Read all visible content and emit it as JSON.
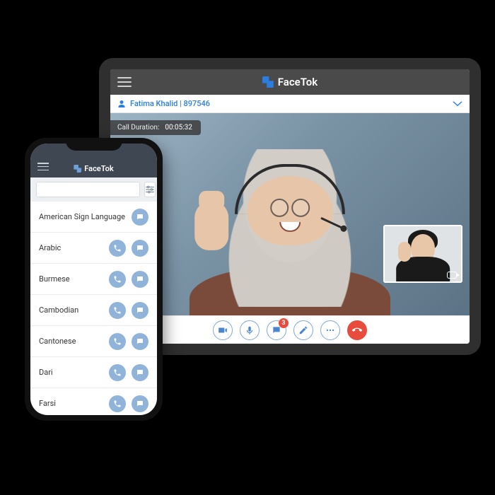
{
  "brand": {
    "name": "FaceTok"
  },
  "colors": {
    "accent": "#2b7de0",
    "danger": "#e74c3c",
    "phoneBtn": "#8fb3d9"
  },
  "tablet": {
    "caller": {
      "name": "Fatima Khalid",
      "id": "897546",
      "display": "Fatima Khalid | 897546"
    },
    "duration": {
      "label": "Call Duration:",
      "value": "00:05:32"
    },
    "chat_badge": "3",
    "toolbar": {
      "video": "Video",
      "mic": "Mic",
      "chat": "Chat",
      "pen": "Annotate",
      "more": "More",
      "hangup": "Hang up"
    }
  },
  "phone": {
    "search_placeholder": "",
    "languages": [
      {
        "label": "American Sign Language",
        "call": false,
        "chat": true
      },
      {
        "label": "Arabic",
        "call": true,
        "chat": true
      },
      {
        "label": "Burmese",
        "call": true,
        "chat": true
      },
      {
        "label": "Cambodian",
        "call": true,
        "chat": true
      },
      {
        "label": "Cantonese",
        "call": true,
        "chat": true
      },
      {
        "label": "Dari",
        "call": true,
        "chat": true
      },
      {
        "label": "Farsi",
        "call": true,
        "chat": true
      }
    ]
  }
}
